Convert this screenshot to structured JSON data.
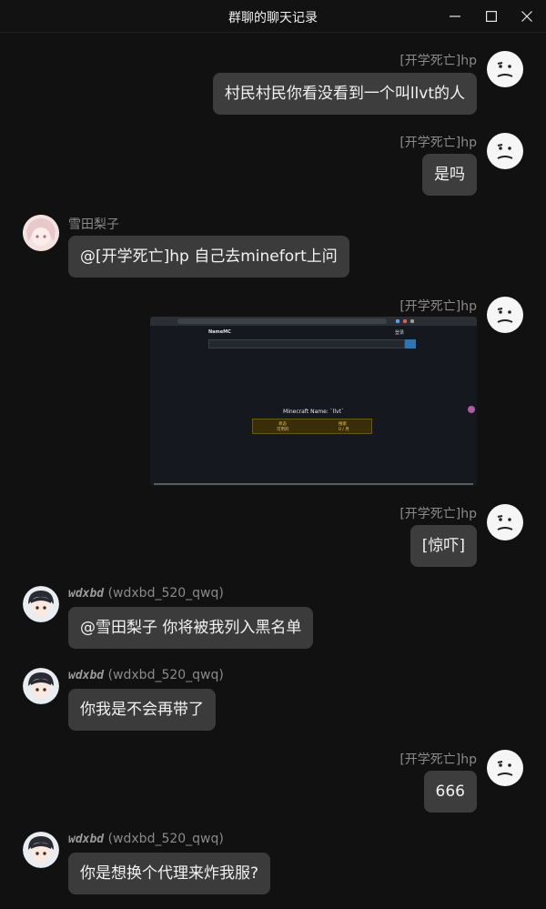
{
  "window": {
    "title": "群聊的聊天记录"
  },
  "messages": [
    {
      "sender": "[开学死亡]hp",
      "side": "right",
      "text": "村民村民你看没看到一个叫llvt的人"
    },
    {
      "sender": "[开学死亡]hp",
      "side": "right",
      "text": "是吗"
    },
    {
      "sender": "雪田梨子",
      "side": "left",
      "text": "@[开学死亡]hp 自己去minefort上问"
    },
    {
      "sender": "[开学死亡]hp",
      "side": "right",
      "image": {
        "site_name": "NameMC",
        "heading": "Minecraft Name: `llvt`",
        "status_left": "状态",
        "status_left_value": "可用的",
        "status_right": "搜索",
        "status_right_value": "0 / 月",
        "signin": "登录"
      }
    },
    {
      "sender": "[开学死亡]hp",
      "side": "right",
      "text": "[惊吓]"
    },
    {
      "sender": "wdxbd",
      "sender_id": "(wdxbd_520_qwq)",
      "side": "left",
      "text": "@雪田梨子 你将被我列入黑名单"
    },
    {
      "sender": "wdxbd",
      "sender_id": "(wdxbd_520_qwq)",
      "side": "left",
      "text": "你我是不会再带了"
    },
    {
      "sender": "[开学死亡]hp",
      "side": "right",
      "text": "666"
    },
    {
      "sender": "wdxbd",
      "sender_id": "(wdxbd_520_qwq)",
      "side": "left",
      "text": "你是想换个代理来炸我服?"
    }
  ],
  "colors": {
    "background": "#111111",
    "bubble": "#3b3b3b",
    "name_text": "#8a8a8a",
    "namemc_accent": "#2e75b6",
    "status_box": "#3a2e08"
  }
}
